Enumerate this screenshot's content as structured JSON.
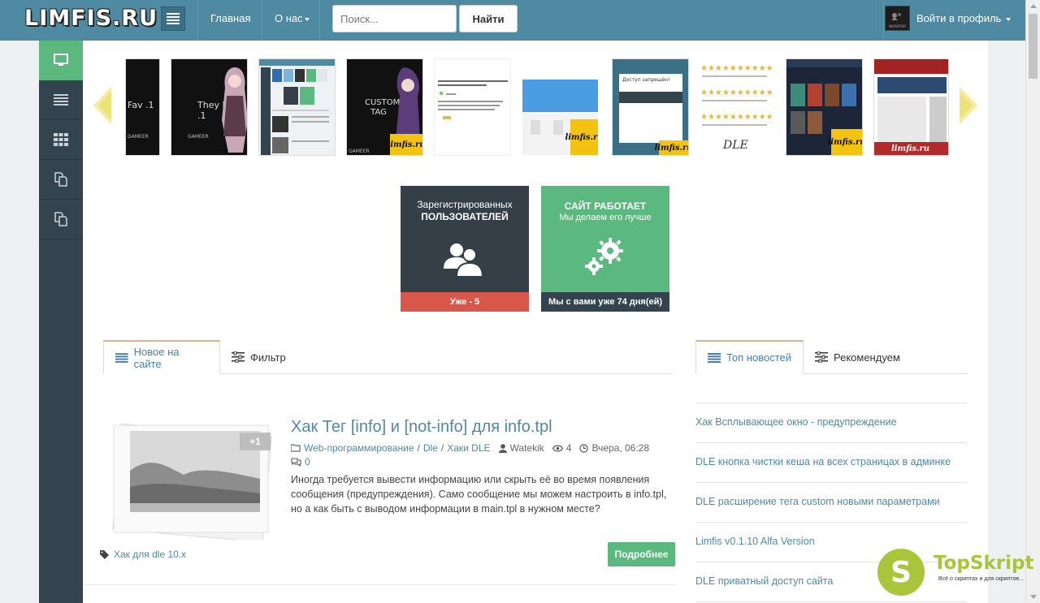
{
  "header": {
    "logo": "LIMFIS.RU",
    "nav": [
      {
        "label": "Главная"
      },
      {
        "label": "О нас"
      }
    ],
    "search": {
      "placeholder": "Поиск...",
      "button": "Найти"
    },
    "profile": {
      "label": "Войти в профиль",
      "avatar_text": "NOAVATAR"
    }
  },
  "sidebar": {
    "items": [
      {
        "icon": "monitor-icon",
        "active": true
      },
      {
        "icon": "list-icon",
        "active": false
      },
      {
        "icon": "grid-icon",
        "active": false
      },
      {
        "icon": "copy-icon",
        "active": false
      },
      {
        "icon": "copy-icon",
        "active": false
      }
    ]
  },
  "slider": {
    "thumbs": [
      {
        "caption": "Fav .1"
      },
      {
        "caption": "They Fav .1"
      },
      {
        "caption": ""
      },
      {
        "caption": "CUSTOM TAG"
      },
      {
        "caption": ""
      },
      {
        "caption": ""
      },
      {
        "caption": "Доступ запрещён!"
      },
      {
        "caption": ""
      },
      {
        "caption": ""
      },
      {
        "caption": ""
      }
    ],
    "badge": "limfis.ru"
  },
  "tiles": {
    "users": {
      "line1": "Зарегистрированных",
      "line2": "ПОЛЬЗОВАТЕЛЕЙ",
      "footer": "Уже - 5"
    },
    "site": {
      "line1": "САЙТ РАБОТАЕТ",
      "line2": "Мы делаем его лучше",
      "footer": "Мы с вами уже 74 дня(ей)"
    }
  },
  "tabs_left": [
    {
      "label": "Новое на сайте",
      "active": true
    },
    {
      "label": "Фильтр",
      "active": false
    }
  ],
  "tabs_right": [
    {
      "label": "Топ новостей",
      "active": true
    },
    {
      "label": "Рекомендуем",
      "active": false
    }
  ],
  "article": {
    "photo_badge": "+1",
    "title": "Хак Тег [info] и [not-info] для info.tpl",
    "categories": [
      "Web-программирование",
      "Dle",
      "Хаки DLE"
    ],
    "author": "Watekik",
    "views": "4",
    "date": "Вчера, 06:28",
    "comments": "0",
    "text": "Иногда требуется вывести информацию или скрыть её во время появления сообщения (предупреждения). Само сообщение мы можем настроить в info.tpl, но а как быть с выводом информации в main.tpl в нужном месте?",
    "tag": "Хак для dle 10.x",
    "more_button": "Подробнее"
  },
  "top_news": [
    "Хак Всплывающее окно - предупреждение",
    "DLE кнопка чистки кеша на всех страницах в админке",
    "DLE расширение тега custom новыми параметрами",
    "Limfis v0.1.10 Alfa Version",
    "DLE приватный доступ сайта"
  ],
  "watermark": {
    "letter": "S",
    "name": "TopSkript",
    "sub": "Всё о скриптах и для скриптов..."
  }
}
